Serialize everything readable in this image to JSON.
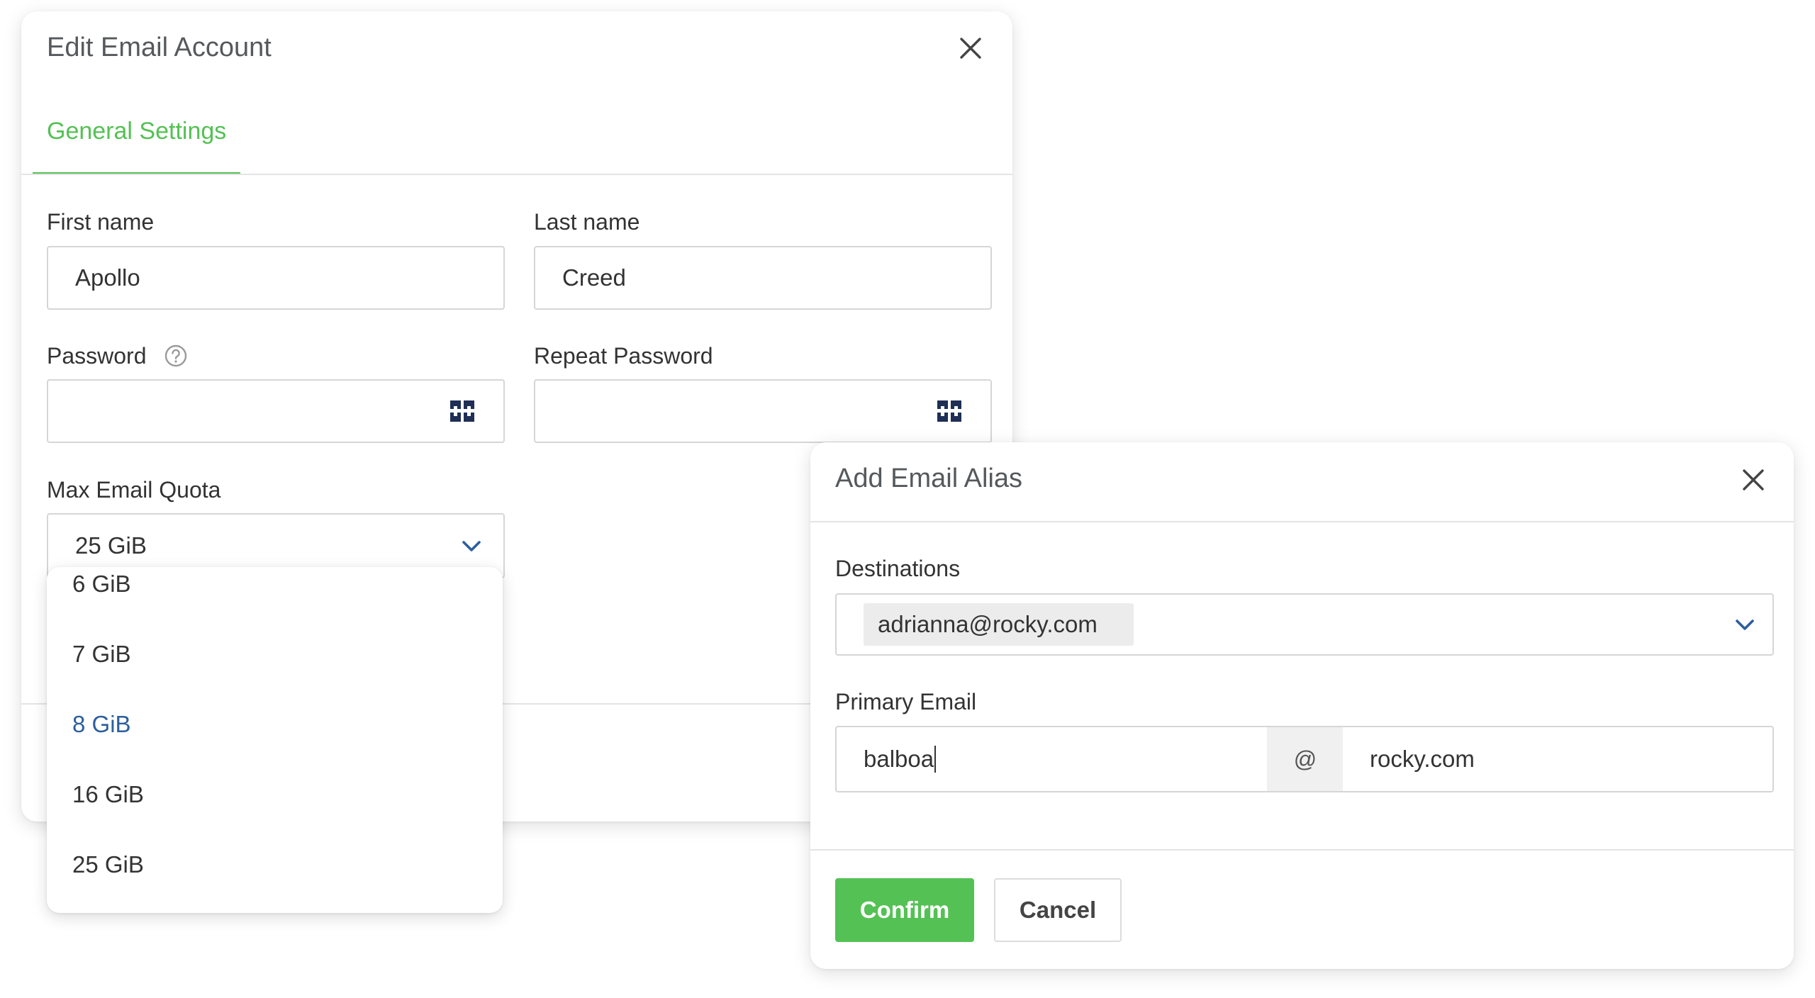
{
  "edit_account": {
    "title": "Edit Email Account",
    "close_icon": "close-icon",
    "tabs": [
      {
        "label": "General Settings",
        "active": true
      }
    ],
    "first_name": {
      "label": "First name",
      "value": "Apollo"
    },
    "last_name": {
      "label": "Last name",
      "value": "Creed"
    },
    "password": {
      "label": "Password",
      "value": "",
      "help_icon": "question-circle-icon",
      "generator_icon": "password-generator-icon"
    },
    "repeat_password": {
      "label": "Repeat Password",
      "value": "",
      "generator_icon": "password-generator-icon"
    },
    "max_quota": {
      "label": "Max Email Quota",
      "value": "25 GiB",
      "options": [
        "6 GiB",
        "7 GiB",
        "8 GiB",
        "16 GiB",
        "25 GiB"
      ],
      "highlighted": "8 GiB"
    }
  },
  "add_alias": {
    "title": "Add Email Alias",
    "close_icon": "close-icon",
    "destinations": {
      "label": "Destinations",
      "tags": [
        "adrianna@rocky.com"
      ]
    },
    "primary_email": {
      "label": "Primary Email",
      "local_part": "balboa",
      "at_symbol": "@",
      "domain": "rocky.com"
    },
    "confirm_label": "Confirm",
    "cancel_label": "Cancel"
  },
  "colors": {
    "accent_green": "#54c154",
    "link_blue": "#2c5f9e",
    "title_gray": "#56595c",
    "border_gray": "#d6d6d6"
  }
}
